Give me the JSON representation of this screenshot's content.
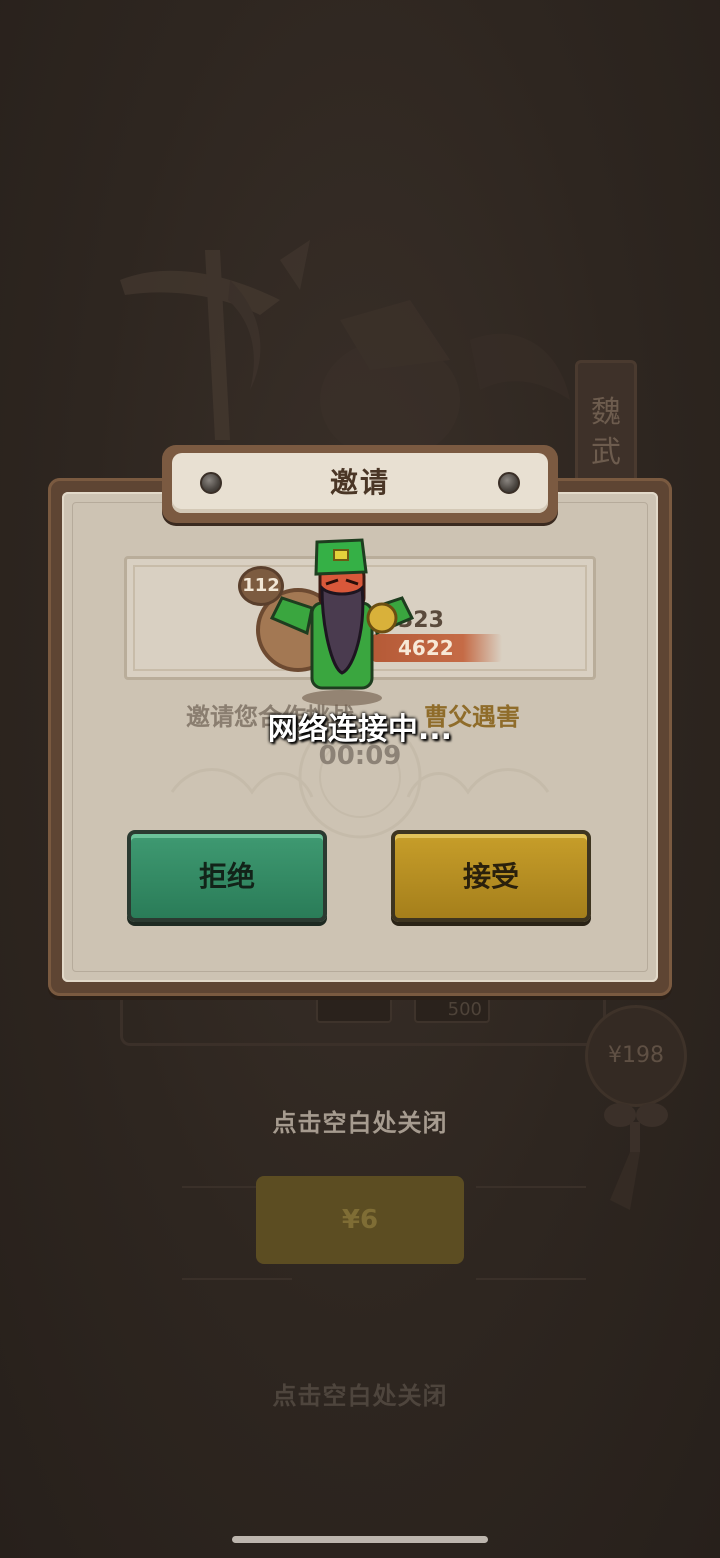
{
  "background": {
    "banner_text": "魏武",
    "slot_value": "500",
    "price_circle": "¥198",
    "close_hint": "点击空白处关闭",
    "buy_button": "¥6",
    "close_hint_lower": "点击空白处关闭"
  },
  "dialog": {
    "title": "邀请",
    "player": {
      "level": "112",
      "id": "323",
      "power": "4622"
    },
    "invite_text": "邀请您合作挑战",
    "stage_name": "曹父遇害",
    "loading_text": "网络连接中...",
    "timer": "00:09",
    "reject_label": "拒绝",
    "accept_label": "接受"
  },
  "colors": {
    "reject": "#2f8a62",
    "accept": "#b8901f",
    "paper": "#cdc3b3"
  }
}
